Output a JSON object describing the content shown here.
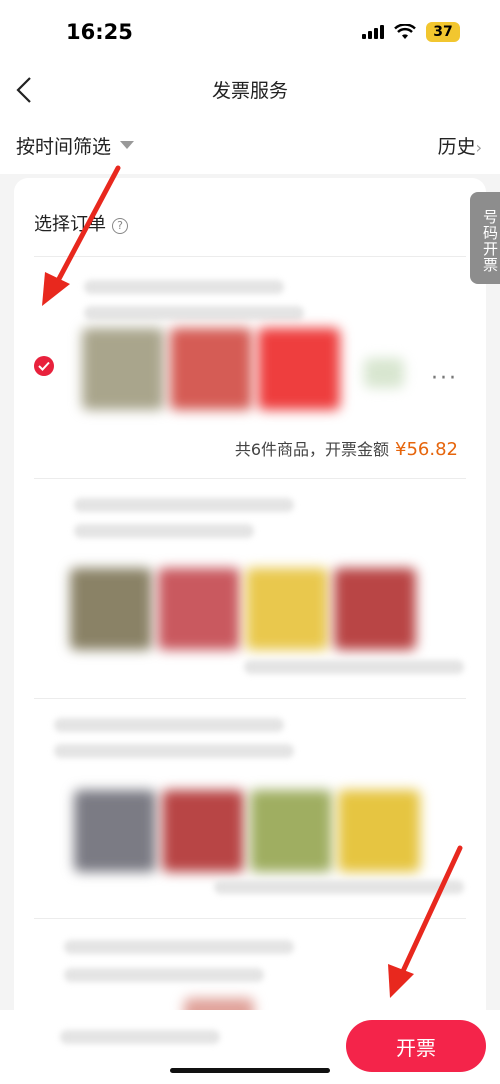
{
  "status_bar": {
    "time": "16:25",
    "battery": "37"
  },
  "nav": {
    "title": "发票服务"
  },
  "filter": {
    "label": "按时间筛选",
    "history": "历史"
  },
  "side_tab": {
    "label": "号码开票"
  },
  "section": {
    "header": "选择订单"
  },
  "orders": [
    {
      "selected": true,
      "summary_text": "共6件商品，开票金额",
      "amount": "¥56.82"
    },
    {
      "selected": false
    },
    {
      "selected": false
    },
    {
      "selected": false
    }
  ],
  "bottom": {
    "submit_label": "开票"
  },
  "colors": {
    "accent": "#f4244a",
    "amount": "#e6650c",
    "arrow": "#e8281e"
  }
}
